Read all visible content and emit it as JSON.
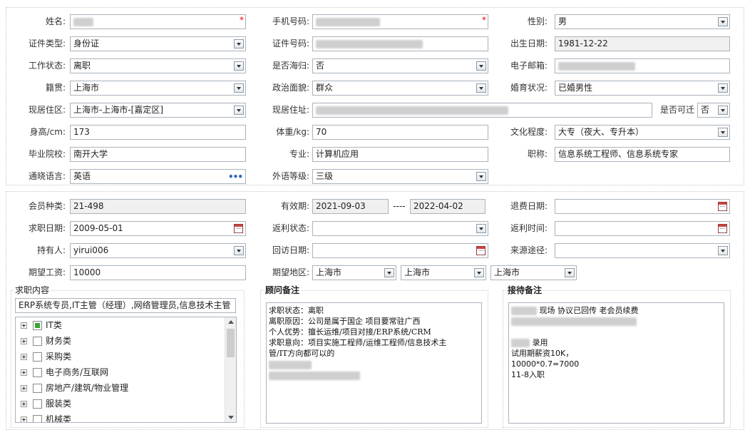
{
  "personal": {
    "name": {
      "label": "姓名:",
      "value": ""
    },
    "mobile": {
      "label": "手机号码:",
      "value": ""
    },
    "gender": {
      "label": "性别:",
      "value": "男"
    },
    "id_type": {
      "label": "证件类型:",
      "value": "身份证"
    },
    "id_number": {
      "label": "证件号码:",
      "value": ""
    },
    "birth_date": {
      "label": "出生日期:",
      "value": "1981-12-22"
    },
    "work_status": {
      "label": "工作状态:",
      "value": "离职"
    },
    "returnee": {
      "label": "是否海归:",
      "value": "否"
    },
    "email": {
      "label": "电子邮箱:",
      "value": ""
    },
    "native_place": {
      "label": "籍贯:",
      "value": "上海市"
    },
    "political": {
      "label": "政治面貌:",
      "value": "群众"
    },
    "marital": {
      "label": "婚育状况:",
      "value": "已婚男性"
    },
    "residence_area": {
      "label": "现居住区:",
      "value": "上海市-上海市-[嘉定区]"
    },
    "address": {
      "label": "现居住址:",
      "value": ""
    },
    "migrate": {
      "label": "是否可迁",
      "value": "否"
    },
    "height": {
      "label": "身高/cm:",
      "value": "173"
    },
    "weight": {
      "label": "体重/kg:",
      "value": "70"
    },
    "education": {
      "label": "文化程度:",
      "value": "大专（夜大、专升本）"
    },
    "school": {
      "label": "毕业院校:",
      "value": "南开大学"
    },
    "major": {
      "label": "专业:",
      "value": "计算机应用"
    },
    "title": {
      "label": "职称:",
      "value": "信息系统工程师、信息系统专家"
    },
    "language": {
      "label": "通晓语言:",
      "value": "英语"
    },
    "lang_level": {
      "label": "外语等级:",
      "value": "三级"
    }
  },
  "membership": {
    "member_type": {
      "label": "会员种类:",
      "value": "21-498"
    },
    "valid": {
      "label": "有效期:",
      "start": "2021-09-03",
      "sep": "----",
      "end": "2022-04-02"
    },
    "refund_date": {
      "label": "退费日期:",
      "value": ""
    },
    "apply_date": {
      "label": "求职日期:",
      "value": "2009-05-01"
    },
    "rebate_status": {
      "label": "返利状态:",
      "value": ""
    },
    "rebate_time": {
      "label": "返利时间:",
      "value": ""
    },
    "holder": {
      "label": "持有人:",
      "value": "yirui006"
    },
    "visit_date": {
      "label": "回访日期:",
      "value": ""
    },
    "source": {
      "label": "来源途径:",
      "value": ""
    },
    "salary": {
      "label": "期望工资:",
      "value": "10000"
    },
    "region": {
      "label": "期望地区:",
      "v1": "上海市",
      "v2": "上海市",
      "v3": "上海市"
    }
  },
  "job_content": {
    "legend": "求职内容",
    "summary": "ERP系统专员,IT主管（经理）,网络管理员,信息技术主管",
    "tree": [
      {
        "label": "IT类",
        "checked": true
      },
      {
        "label": "财务类",
        "checked": false
      },
      {
        "label": "采购类",
        "checked": false
      },
      {
        "label": "电子商务/互联网",
        "checked": false
      },
      {
        "label": "房地产/建筑/物业管理",
        "checked": false
      },
      {
        "label": "服装类",
        "checked": false
      },
      {
        "label": "机械类",
        "checked": false
      }
    ]
  },
  "advisor_notes": {
    "legend": "顾问备注",
    "lines": [
      "求职状态：离职",
      "离职原因：公司是属于国企 项目要常驻广西",
      "个人优势：擅长运维/项目对接/ERP系统/CRM",
      "求职意向：项目实施工程师/运维工程师/信息技术主",
      "管/IT方向都可以的"
    ]
  },
  "reception_notes": {
    "legend": "接待备注",
    "line1": "现场 协议已回传 老会员续费",
    "line2": "录用",
    "lines": [
      "试用期薪资10K，",
      "10000*0.7=7000",
      "11-8入职"
    ]
  }
}
